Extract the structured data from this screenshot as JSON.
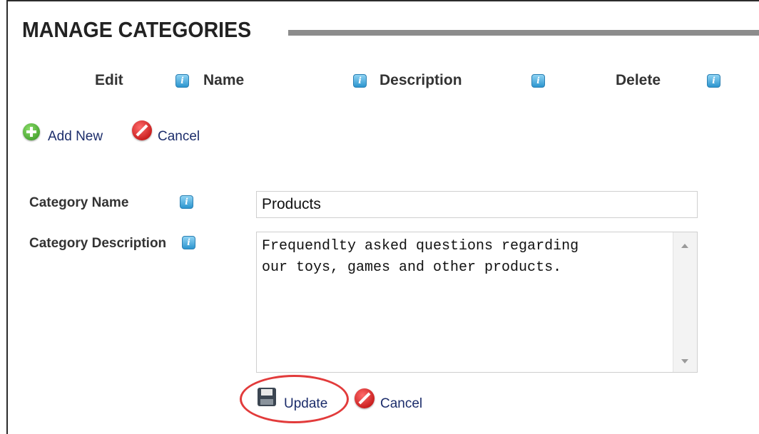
{
  "page": {
    "title": "MANAGE CATEGORIES"
  },
  "columns": {
    "edit": "Edit",
    "name": "Name",
    "description": "Description",
    "delete": "Delete"
  },
  "toolbar": {
    "add_new": "Add New",
    "cancel": "Cancel"
  },
  "form": {
    "category_name_label": "Category Name",
    "category_name_value": "Products",
    "category_description_label": "Category Description",
    "category_description_value": "Frequendlty asked questions regarding\nour toys, games and other products.",
    "update": "Update",
    "cancel": "Cancel"
  },
  "icons": {
    "help": "help-icon",
    "add": "add-circle-icon",
    "cancel": "cancel-circle-icon",
    "save": "save-disk-icon"
  },
  "colors": {
    "link": "#1c2d6b",
    "help_icon": "#2c95cf",
    "add_icon": "#2e8d1d",
    "cancel_icon": "#b30000",
    "highlight_ring": "#e23b3b"
  }
}
